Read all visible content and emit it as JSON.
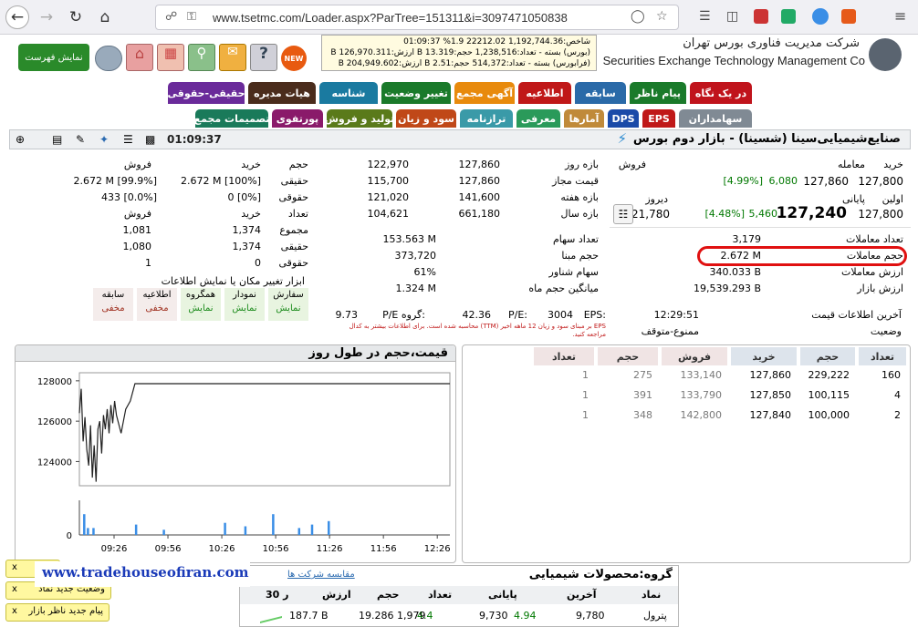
{
  "browser": {
    "url": "www.tsetmc.com/Loader.aspx?ParTree=151311&i=3097471050838"
  },
  "header": {
    "show_list_label": "نمایش فهرست",
    "company_fa": "شرکت مدیریت فناوری بورس تهران",
    "company_en": "Securities Exchange Technology Management Co",
    "new_label": "NEW",
    "market_box": [
      "شاخص:1,192,744.36 22212.02 1.9% 01:09:37",
      "(بورس) بسته - تعداد:1,238,516 حجم:13.319 B ارزش:126,970.311 B",
      "(فرابورس) بسته - تعداد:514,372 حجم:2.51 B ارزش:204,949.602 B"
    ]
  },
  "tabs_row1": [
    {
      "label": "در یک نگاه",
      "color": "#c0141c"
    },
    {
      "label": "پیام ناظر",
      "color": "#1a7a2a"
    },
    {
      "label": "سابقه",
      "color": "#2a6aa8"
    },
    {
      "label": "اطلاعیه",
      "color": "#c01818"
    },
    {
      "label": "آگهی مجمع",
      "color": "#e88a0c"
    },
    {
      "label": "تغییر وضعیت",
      "color": "#1a7a2a"
    },
    {
      "label": "شناسه",
      "color": "#1a7aa0"
    },
    {
      "label": "هیات مدیره",
      "color": "#4a2c1c"
    },
    {
      "label": "حقیقی-حقوقی",
      "color": "#6a2a9a"
    }
  ],
  "tabs_row2": [
    {
      "label": "سهامداران",
      "color": "#808a94"
    },
    {
      "label": "EPS",
      "color": "#c01818"
    },
    {
      "label": "DPS",
      "color": "#1a4aa8"
    },
    {
      "label": "آمارها",
      "color": "#c08a3a"
    },
    {
      "label": "معرفی",
      "color": "#2a9a5a"
    },
    {
      "label": "ترازنامه",
      "color": "#3a9aa8"
    },
    {
      "label": "سود و زیان",
      "color": "#c04818"
    },
    {
      "label": "تولید و فروش",
      "color": "#5a7a1a"
    },
    {
      "label": "پورتفوی",
      "color": "#8a1a6a"
    },
    {
      "label": "تصمیمات مجمع",
      "color": "#1a7a5a"
    }
  ],
  "instrument": {
    "title": "صنایع‌شیمیایی‌سینا (شسینا) - بازار دوم بورس",
    "time": "01:09:37"
  },
  "price": {
    "trade_label": "معامله",
    "trade_value": "127,860",
    "trade_change": "6,080",
    "trade_pct": "[4.99%]",
    "final_label": "پایانی",
    "final_value": "127,240",
    "final_change": "5,460",
    "final_pct": "[4.48%]",
    "buy_label": "خرید",
    "buy_value": "127,800",
    "sell_label": "فروش",
    "first_label": "اولین",
    "first_value": "127,800",
    "yesterday_label": "دیروز",
    "yesterday_value": "121,780",
    "ranges": [
      {
        "label": "بازه روز",
        "a": "127,860",
        "b": "122,970"
      },
      {
        "label": "قیمت مجاز",
        "a": "127,860",
        "b": "115,700"
      },
      {
        "label": "بازه هفته",
        "a": "141,600",
        "b": "121,020"
      },
      {
        "label": "بازه سال",
        "a": "661,180",
        "b": "104,621"
      }
    ]
  },
  "stats_left": [
    {
      "label": "تعداد معاملات",
      "value": "3,179"
    },
    {
      "label": "حجم معاملات",
      "value": "2.672 M"
    },
    {
      "label": "ارزش معاملات",
      "value": "340.033 B"
    },
    {
      "label": "ارزش بازار",
      "value": "19,539.293 B"
    }
  ],
  "stats_right": [
    {
      "label": "تعداد سهام",
      "value": "153.563 M"
    },
    {
      "label": "حجم مبنا",
      "value": "373,720"
    },
    {
      "label": "سهام شناور",
      "value": "61%"
    },
    {
      "label": "میانگین حجم ماه",
      "value": "1.324 M"
    }
  ],
  "status": {
    "last_info_label": "آخرین اطلاعات قیمت",
    "last_info_value": "12:29:51",
    "state_label": "وضعیت",
    "state_value": "ممنوع-متوقف",
    "eps_label": "EPS:",
    "eps_value": "3004",
    "pe_label": "P/E:",
    "pe_value": "42.36",
    "gpe_label": "P/E گروه:",
    "gpe_value": "9.73",
    "eps_note": "EPS بر مبنای سود و زیان 12 ماهه اخیر (TTM) محاسبه شده است. برای اطلاعات بیشتر به کدال مراجعه کنید."
  },
  "client": {
    "headers": [
      "خرید",
      "فروش"
    ],
    "rows": [
      {
        "label": "حجم",
        "buy": "",
        "sell": ""
      },
      {
        "label": "حقیقی",
        "buy": "2.672 M [100%]",
        "sell": "2.672 M [99.9%]"
      },
      {
        "label": "حقوقی",
        "buy": "0 [0%]",
        "sell": "433 [0.0%]"
      }
    ],
    "headers2": [
      "خرید",
      "فروش"
    ],
    "rows2": [
      {
        "label": "تعداد",
        "buy": "",
        "sell": ""
      },
      {
        "label": "مجموع",
        "buy": "1,374",
        "sell": "1,081"
      },
      {
        "label": "حقیقی",
        "buy": "1,374",
        "sell": "1,080"
      },
      {
        "label": "حقوقی",
        "buy": "0",
        "sell": "1"
      }
    ]
  },
  "tools": {
    "title": "ابزار تغییر مکان یا نمایش اطلاعات",
    "items": [
      {
        "name": "سفارش",
        "state": "نمایش",
        "on": true
      },
      {
        "name": "نمودار",
        "state": "نمایش",
        "on": true
      },
      {
        "name": "همگروه",
        "state": "نمایش",
        "on": true
      },
      {
        "name": "اطلاعیه",
        "state": "مخفی",
        "on": false
      },
      {
        "name": "سابقه",
        "state": "مخفی",
        "on": false
      }
    ]
  },
  "chart_data": {
    "type": "line",
    "title": "قیمت،حجم در طول روز",
    "x_ticks": [
      "09:26",
      "09:56",
      "10:26",
      "10:56",
      "11:26",
      "11:56",
      "12:26"
    ],
    "y_ticks": [
      "128000",
      "126000",
      "124000"
    ],
    "ylim": [
      122800,
      128400
    ],
    "volume_tick": "0",
    "x": [
      0,
      2,
      4,
      6,
      8,
      10,
      12,
      14,
      16,
      18,
      20,
      22,
      24,
      26,
      28,
      30,
      32,
      34,
      36,
      38,
      40,
      45,
      50,
      55,
      60,
      70,
      80,
      90,
      100,
      110,
      120,
      130,
      140,
      150,
      160,
      170,
      180,
      190,
      200,
      210,
      220,
      230,
      240,
      250,
      260,
      270,
      280,
      290,
      300,
      310,
      320,
      330,
      340,
      350,
      360,
      370,
      380,
      390,
      400
    ],
    "y": [
      126400,
      127600,
      125000,
      126200,
      124600,
      123800,
      125800,
      123200,
      124800,
      123000,
      125600,
      126000,
      124400,
      126300,
      125600,
      126600,
      125400,
      126800,
      125900,
      127000,
      126300,
      125400,
      126600,
      127000,
      127860,
      127860,
      127860,
      127860,
      127860,
      127860,
      127860,
      127860,
      127860,
      127860,
      127860,
      127860,
      127860,
      127860,
      127860,
      127860,
      127860,
      127860,
      127860,
      127860,
      127860,
      127860,
      127860,
      127860,
      127860,
      127860,
      127860,
      127860,
      127860,
      127860,
      127860,
      127860,
      127860,
      127860,
      127860
    ]
  },
  "orders": {
    "headers": [
      "تعداد",
      "حجم",
      "خرید",
      "فروش",
      "حجم",
      "تعداد"
    ],
    "rows": [
      [
        "160",
        "229,222",
        "127,860",
        "133,140",
        "275",
        "1"
      ],
      [
        "4",
        "100,115",
        "127,850",
        "133,790",
        "391",
        "1"
      ],
      [
        "2",
        "100,000",
        "127,840",
        "142,800",
        "348",
        "1"
      ]
    ]
  },
  "group": {
    "title": "گروه:محصولات شیمیایی",
    "compare_link": "مقایسه شرکت ها",
    "headers": [
      "نماد",
      "آخرین",
      "پایانی",
      "تعداد",
      "حجم",
      "ارزش",
      "30 ر"
    ],
    "row": [
      "پترول",
      "9,780",
      "4.94",
      "9,730",
      "4.4",
      "1,979",
      "19.286",
      "187.7 B"
    ]
  },
  "notifications": [
    {
      "label": "کدال",
      "close": "x"
    },
    {
      "label": "وضعیت جدید نماد",
      "close": "x"
    },
    {
      "label": "پیام جدید ناظر بازار",
      "close": "x"
    }
  ],
  "watermark": "www.tradehouseofiran.com"
}
